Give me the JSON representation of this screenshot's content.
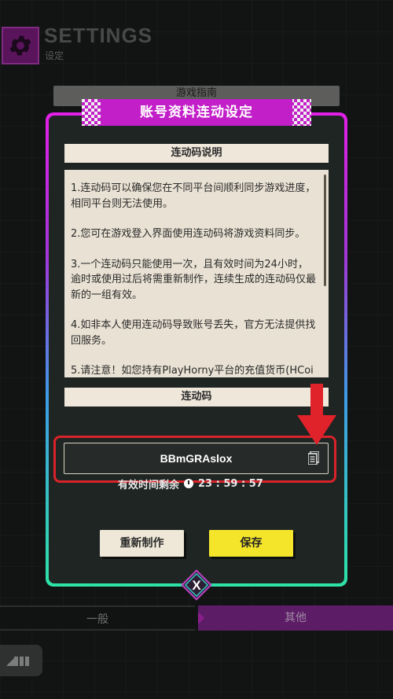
{
  "header": {
    "title": "SETTINGS",
    "subtitle": "设定",
    "icon": "gear-icon"
  },
  "background": {
    "guide_tab": "游戏指南"
  },
  "modal": {
    "title": "账号资料连动设定",
    "explain_header": "连动码说明",
    "paragraphs": [
      "1.连动码可以确保您在不同平台间顺利同步游戏进度，相同平台则无法使用。",
      "2.您可在游戏登入界面使用连动码将游戏资料同步。",
      "3.一个连动码只能使用一次，且有效时间为24小时，逾时或使用过后将需重新制作，连续生成的连动码仅最新的一组有效。",
      "4.如非本人使用连动码导致账号丢失，官方无法提供找回服务。",
      "5.请注意！如您持有PlayHorny平台的充值货币(HCoi"
    ],
    "code_header": "连动码",
    "code_value": "BBmGRAslox",
    "timer_label": "有效时间剩余",
    "timer_value": "23 : 59 : 57",
    "regen_button": "重新制作",
    "save_button": "保存",
    "close_symbol": "X"
  },
  "tabs": {
    "general": "一般",
    "other": "其他"
  },
  "colors": {
    "accent_magenta": "#c21fc8",
    "save_yellow": "#f4e52a",
    "highlight_red": "#d8232a"
  }
}
